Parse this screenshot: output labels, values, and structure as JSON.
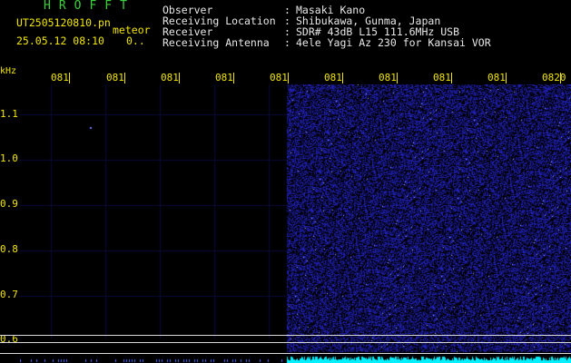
{
  "app": {
    "title": "HROFFT",
    "file": "UT2505120810.pn",
    "meteor_label": "meteor",
    "datetime": "25.05.12 08:10",
    "count": "0..",
    "colors": {
      "green": "#3ad23a",
      "yellow": "#f2e600",
      "noise": "#1a1aa8",
      "cyan": "#00f0ff"
    }
  },
  "info": [
    {
      "label": "Observer",
      "value": "Masaki Kano"
    },
    {
      "label": "Receiving Location",
      "value": "Shibukawa, Gunma, Japan"
    },
    {
      "label": "Receiver",
      "value": "SDR# 43dB L15 111.6MHz USB"
    },
    {
      "label": "Receiving Antenna",
      "value": "4ele Yagi Az 230 for Kansai VOR"
    }
  ],
  "spectrogram": {
    "y_unit": "kHz",
    "x_ticks": [
      "081",
      "081",
      "081",
      "081",
      "081",
      "081",
      "081",
      "081",
      "081",
      "0820"
    ],
    "y_ticks": [
      "1.1",
      "1.0",
      "0.9",
      "0.8",
      "0.7",
      "0.6"
    ],
    "y_values": [
      1.1,
      1.0,
      0.9,
      0.8,
      0.7,
      0.6
    ],
    "noise_start_fraction": 0.485
  }
}
